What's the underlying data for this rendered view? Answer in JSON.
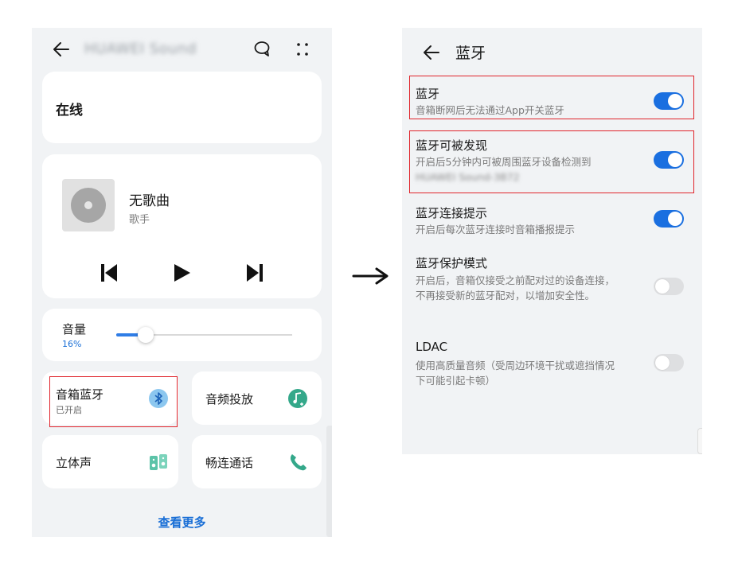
{
  "left": {
    "header": {
      "title": "HUAWEI Sound"
    },
    "status": {
      "online": "在线"
    },
    "player": {
      "song": "无歌曲",
      "artist": "歌手"
    },
    "volume": {
      "label": "音量",
      "percent_text": "16%",
      "level": 0.16
    },
    "tiles": [
      {
        "label": "音箱蓝牙",
        "sub": "已开启",
        "icon": "bluetooth-icon"
      },
      {
        "label": "音频投放",
        "icon": "music-cast-icon"
      },
      {
        "label": "立体声",
        "icon": "stereo-speakers-icon"
      },
      {
        "label": "畅连通话",
        "icon": "phone-icon"
      }
    ],
    "see_more": "查看更多"
  },
  "right": {
    "header": {
      "title": "蓝牙"
    },
    "settings": [
      {
        "title": "蓝牙",
        "desc": "音箱断网后无法通过App开关蓝牙",
        "on": true
      },
      {
        "title": "蓝牙可被发现",
        "desc": "开启后5分钟内可被周围蓝牙设备检测到",
        "desc_blurred": "HUAWEI Sound-3B72",
        "on": true
      },
      {
        "title": "蓝牙连接提示",
        "desc": "开启后每次蓝牙连接时音箱播报提示",
        "on": true
      },
      {
        "title": "蓝牙保护模式",
        "desc": "开启后，音箱仅接受之前配对过的设备连接，不再接受新的蓝牙配对，以增加安全性。",
        "on": false
      },
      {
        "title": "LDAC",
        "desc": "使用高质量音频（受周边环境干扰或遮挡情况下可能引起卡顿）",
        "on": false
      }
    ]
  },
  "colors": {
    "accent": "#1a6fe0",
    "highlight": "#e0242b",
    "background": "#f1f3f5"
  }
}
